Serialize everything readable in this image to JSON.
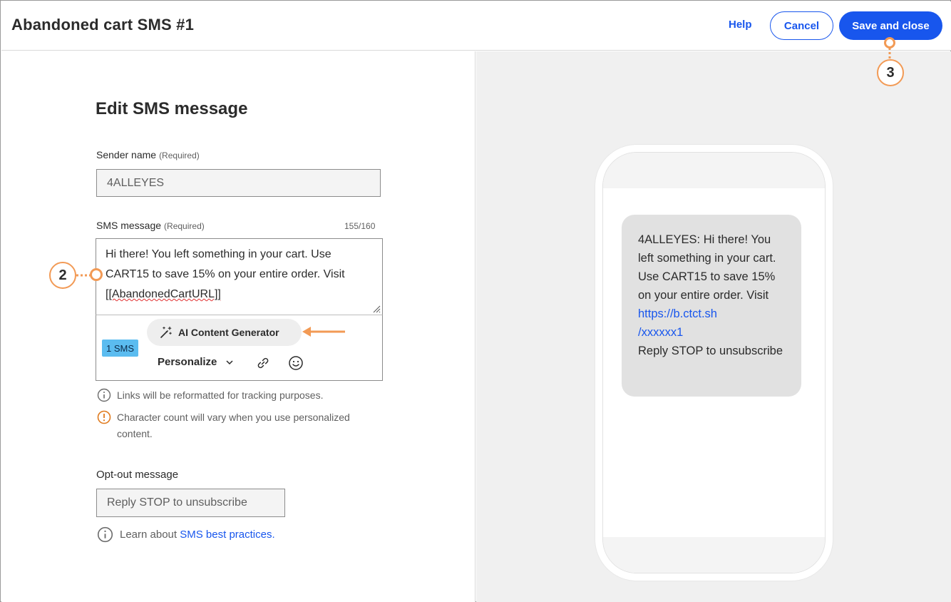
{
  "header": {
    "title": "Abandoned cart SMS #1",
    "help_label": "Help",
    "cancel_label": "Cancel",
    "save_label": "Save and close"
  },
  "editor": {
    "heading": "Edit SMS message",
    "sender_name": {
      "label": "Sender name",
      "required": "(Required)",
      "value": "4ALLEYES"
    },
    "sms_message": {
      "label": "SMS message",
      "required": "(Required)",
      "counter": "155/160",
      "text_before": "Hi there! You left something in your cart. Use CART15 to save 15% on your entire order. Visit ",
      "merge_tag": "[[AbandonedCartURL]]"
    },
    "ai_button_label": "AI Content Generator",
    "sms_count_badge": "1 SMS",
    "personalize_label": "Personalize",
    "notes": {
      "links_note": "Links will be reformatted for tracking purposes.",
      "char_note": "Character count will vary when you use personalized content."
    },
    "opt_out": {
      "label": "Opt-out message",
      "placeholder": "Reply STOP to unsubscribe"
    },
    "learn": {
      "text": "Learn about ",
      "link": "SMS best practices."
    }
  },
  "annotations": {
    "step_2": "2",
    "step_3": "3"
  },
  "preview": {
    "message_text": "4ALLEYES: Hi there! You left something in your cart. Use CART15 to save 15% on your entire order. Visit ",
    "link_text_1": "https://b.ctct.sh",
    "link_text_2": "/xxxxxx1",
    "footer_text": "Reply STOP to unsubscribe"
  },
  "colors": {
    "primary_blue": "#1856ed",
    "annotation_orange": "#f29a55",
    "badge_blue": "#5bbcf0",
    "preview_bg": "#f0f0f0"
  },
  "icons": [
    "magic-wand-icon",
    "chevron-down-icon",
    "link-icon",
    "emoji-icon",
    "info-icon",
    "warning-icon",
    "resize-grip-icon"
  ]
}
